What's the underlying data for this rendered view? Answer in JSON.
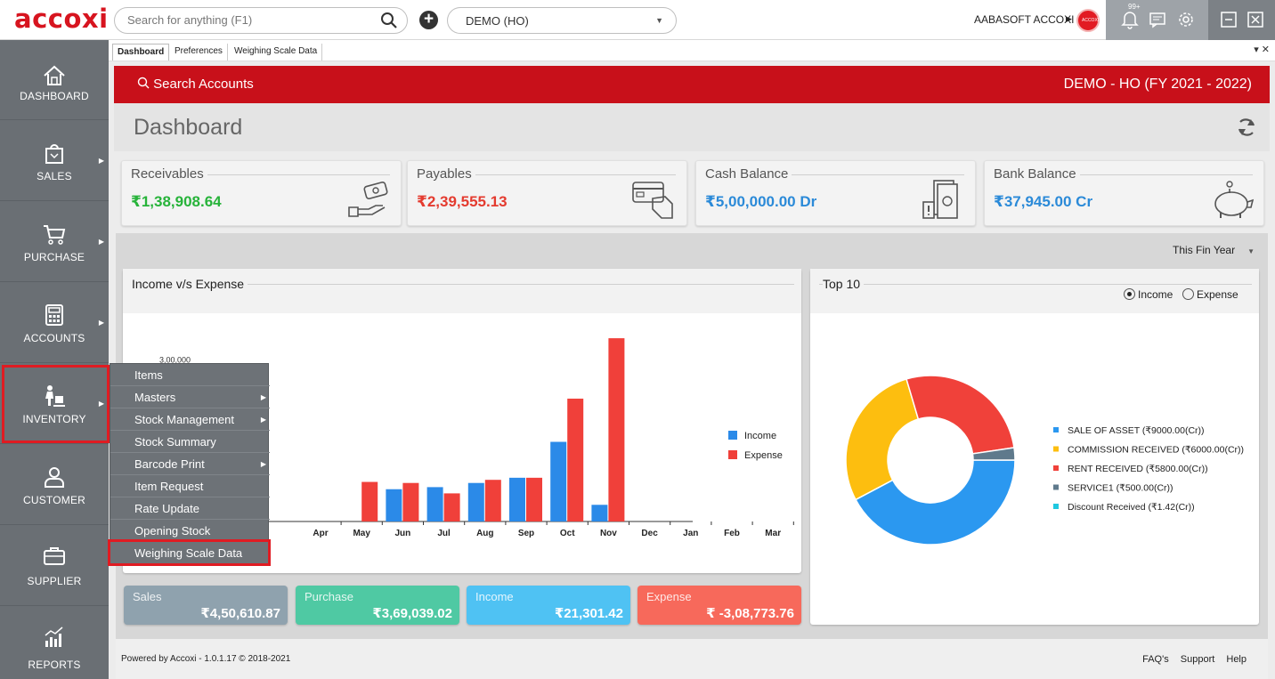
{
  "app": {
    "logo": "accoxi"
  },
  "topbar": {
    "search_placeholder": "Search for anything (F1)",
    "add_label": "+",
    "company_select": "DEMO (HO)",
    "user": "AABASOFT ACCOXI",
    "notif_badge": "99+",
    "avatar_text": "ACCOXI"
  },
  "sidebar": {
    "items": [
      {
        "label": "DASHBOARD",
        "icon": "home-icon"
      },
      {
        "label": "SALES",
        "icon": "shopping-bag-icon"
      },
      {
        "label": "PURCHASE",
        "icon": "cart-icon"
      },
      {
        "label": "ACCOUNTS",
        "icon": "calculator-icon"
      },
      {
        "label": "INVENTORY",
        "icon": "worker-icon"
      },
      {
        "label": "CUSTOMER",
        "icon": "user-icon"
      },
      {
        "label": "SUPPLIER",
        "icon": "briefcase-icon"
      },
      {
        "label": "REPORTS",
        "icon": "report-chart-icon"
      }
    ]
  },
  "tabs": [
    "Dashboard",
    "Preferences",
    "Weighing Scale Data"
  ],
  "tab_controls": "▾ ✕",
  "header": {
    "search": "Search Accounts",
    "company": "DEMO - HO (FY 2021 - 2022)",
    "title": "Dashboard"
  },
  "balances": [
    {
      "label": "Receivables",
      "amount": "₹1,38,908.64",
      "color": "#27b33a",
      "icon": "hand-money-icon"
    },
    {
      "label": "Payables",
      "amount": "₹2,39,555.13",
      "color": "#e43b2f",
      "icon": "card-payment-icon"
    },
    {
      "label": "Cash Balance",
      "amount": "₹5,00,000.00 Dr",
      "color": "#2b8ad8",
      "icon": "cash-icon"
    },
    {
      "label": "Bank Balance",
      "amount": "₹37,945.00 Cr",
      "color": "#2b8ad8",
      "icon": "piggy-bank-icon"
    }
  ],
  "period": "This Fin Year",
  "income_card": {
    "title": "Income v/s Expense"
  },
  "top10_card": {
    "title": "Top 10",
    "radio_income": "Income",
    "radio_expense": "Expense"
  },
  "summary": [
    {
      "label": "Sales",
      "value": "₹4,50,610.87",
      "color": "#8fa2ae"
    },
    {
      "label": "Purchase",
      "value": "₹3,69,039.02",
      "color": "#4fc9a3"
    },
    {
      "label": "Income",
      "value": "₹21,301.42",
      "color": "#4fc2f3"
    },
    {
      "label": "Expense",
      "value": "₹ -3,08,773.76",
      "color": "#f7695b"
    }
  ],
  "footer": {
    "powered": "Powered by Accoxi - 1.0.1.17 © 2018-2021",
    "faq": "FAQ's",
    "support": "Support",
    "help": "Help"
  },
  "flyout": {
    "items": [
      {
        "label": "Items",
        "sub": false
      },
      {
        "label": "Masters",
        "sub": true
      },
      {
        "label": "Stock Management",
        "sub": true
      },
      {
        "label": "Stock Summary",
        "sub": false
      },
      {
        "label": "Barcode Print",
        "sub": true
      },
      {
        "label": "Item Request",
        "sub": false
      },
      {
        "label": "Rate Update",
        "sub": false
      },
      {
        "label": "Opening Stock",
        "sub": false
      },
      {
        "label": "Weighing Scale Data",
        "sub": false
      }
    ]
  },
  "chart_data": [
    {
      "type": "bar",
      "title": "Income v/s Expense",
      "categories": [
        "Apr",
        "May",
        "Jun",
        "Jul",
        "Aug",
        "Sep",
        "Oct",
        "Nov",
        "Dec",
        "Jan",
        "Feb",
        "Mar"
      ],
      "series": [
        {
          "name": "Income",
          "color": "#2b8ae8",
          "values": [
            null,
            null,
            62000,
            66000,
            74000,
            84000,
            153000,
            32000,
            0,
            0,
            0,
            0
          ]
        },
        {
          "name": "Expense",
          "color": "#f0403a",
          "values": [
            null,
            76000,
            74000,
            54000,
            80000,
            84000,
            236000,
            352000,
            0,
            0,
            0,
            0
          ]
        }
      ],
      "ytick_labels": [
        "3,00,000"
      ],
      "ylim": [
        0,
        400000
      ],
      "legend": "right"
    },
    {
      "type": "pie",
      "title": "Top 10",
      "donut": true,
      "labels": [
        "SALE OF ASSET (₹9000.00(Cr))",
        "COMMISSION RECEIVED (₹6000.00(Cr))",
        "RENT RECEIVED (₹5800.00(Cr))",
        "SERVICE1 (₹500.00(Cr))",
        "Discount Received (₹1.42(Cr))"
      ],
      "values": [
        9000,
        6000,
        5800,
        500,
        1.42
      ],
      "colors": [
        "#2b98f0",
        "#fdbe0f",
        "#f0413a",
        "#5f7a8c",
        "#1fc8e0"
      ],
      "legend": "right"
    }
  ]
}
